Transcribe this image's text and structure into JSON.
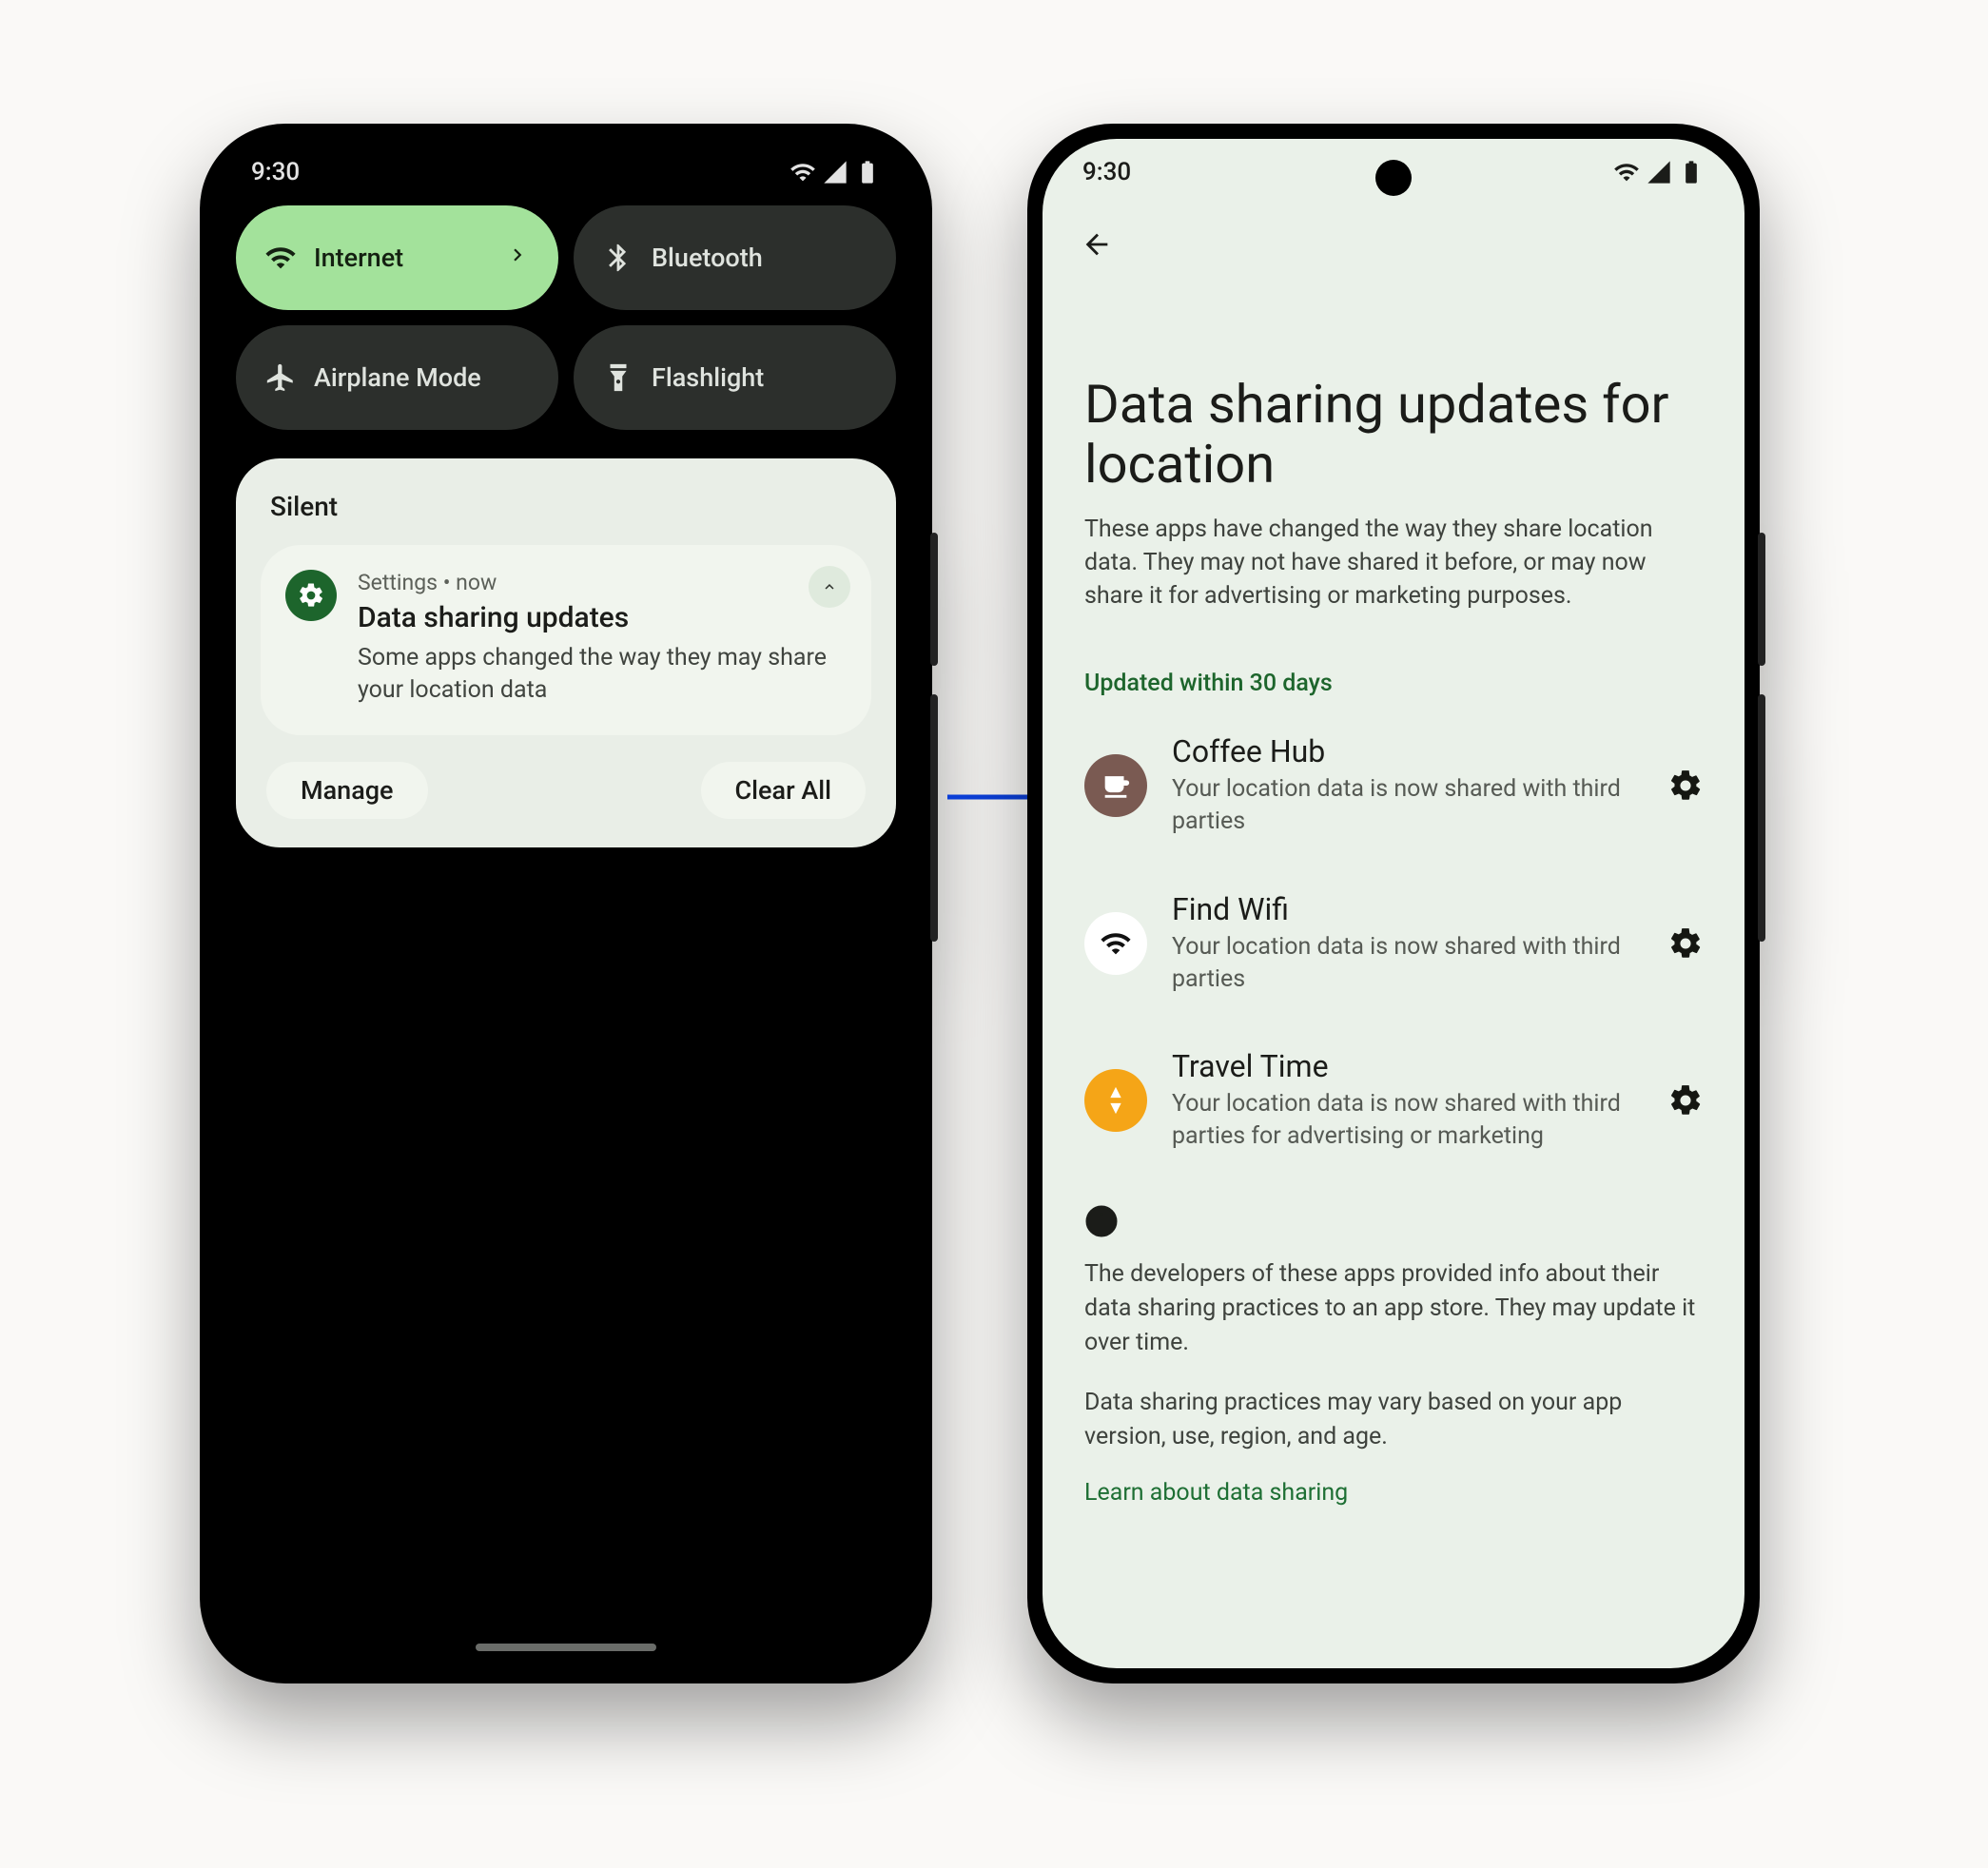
{
  "status": {
    "time": "9:30"
  },
  "qs": {
    "internet": "Internet",
    "bluetooth": "Bluetooth",
    "airplane": "Airplane Mode",
    "flashlight": "Flashlight"
  },
  "shade": {
    "section": "Silent",
    "notification": {
      "app": "Settings",
      "when": "now",
      "sep": "  •  ",
      "title": "Data sharing updates",
      "body": "Some apps changed the way they may share your location data"
    },
    "manage": "Manage",
    "clear_all": "Clear All"
  },
  "page": {
    "title": "Data sharing updates for location",
    "subtitle": "These apps have changed the way they share location data. They may not have shared it before, or may now share it for advertising or marketing purposes.",
    "section": "Updated within 30 days",
    "apps": [
      {
        "name": "Coffee Hub",
        "desc": "Your location data is now shared with third parties"
      },
      {
        "name": "Find Wifi",
        "desc": "Your location data is now shared with third parties"
      },
      {
        "name": "Travel Time",
        "desc": "Your location data is now shared with third parties for advertising or marketing"
      }
    ],
    "info1": "The developers of these apps provided info about their data sharing practices to an app store. They may update it over time.",
    "info2": "Data sharing practices may vary based on your app version, use, region, and age.",
    "learn": "Learn about data sharing"
  }
}
